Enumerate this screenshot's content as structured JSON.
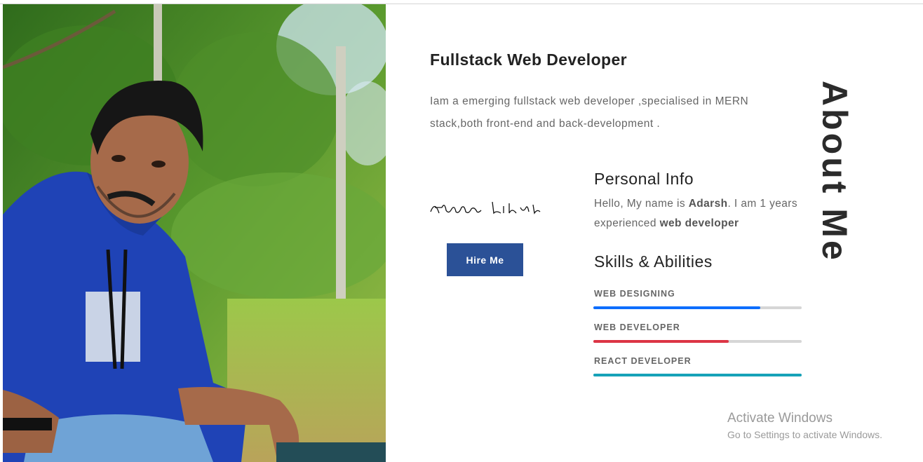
{
  "hero": {
    "title": "Fullstack Web Developer",
    "intro": "Iam a emerging fullstack web developer ,specialised in MERN stack,both front-end and back-development ."
  },
  "signature": {
    "text": "Alexander Likolika"
  },
  "hire_button": {
    "label": "Hire Me"
  },
  "personal_info": {
    "heading": "Personal Info",
    "part1": "Hello, My name is ",
    "name": "Adarsh",
    "part2": ". I am 1 years experienced ",
    "role": "web developer"
  },
  "skills": {
    "heading": "Skills & Abilities",
    "items": [
      {
        "label": "WEB DESIGNING",
        "percent": 80,
        "color": "#0d6efd"
      },
      {
        "label": "WEB DEVELOPER",
        "percent": 65,
        "color": "#dc3545"
      },
      {
        "label": "REACT DEVELOPER",
        "percent": 100,
        "color": "#17a2b8"
      }
    ]
  },
  "side_title": "About Me",
  "watermark": {
    "title": "Activate Windows",
    "subtitle": "Go to Settings to activate Windows."
  }
}
